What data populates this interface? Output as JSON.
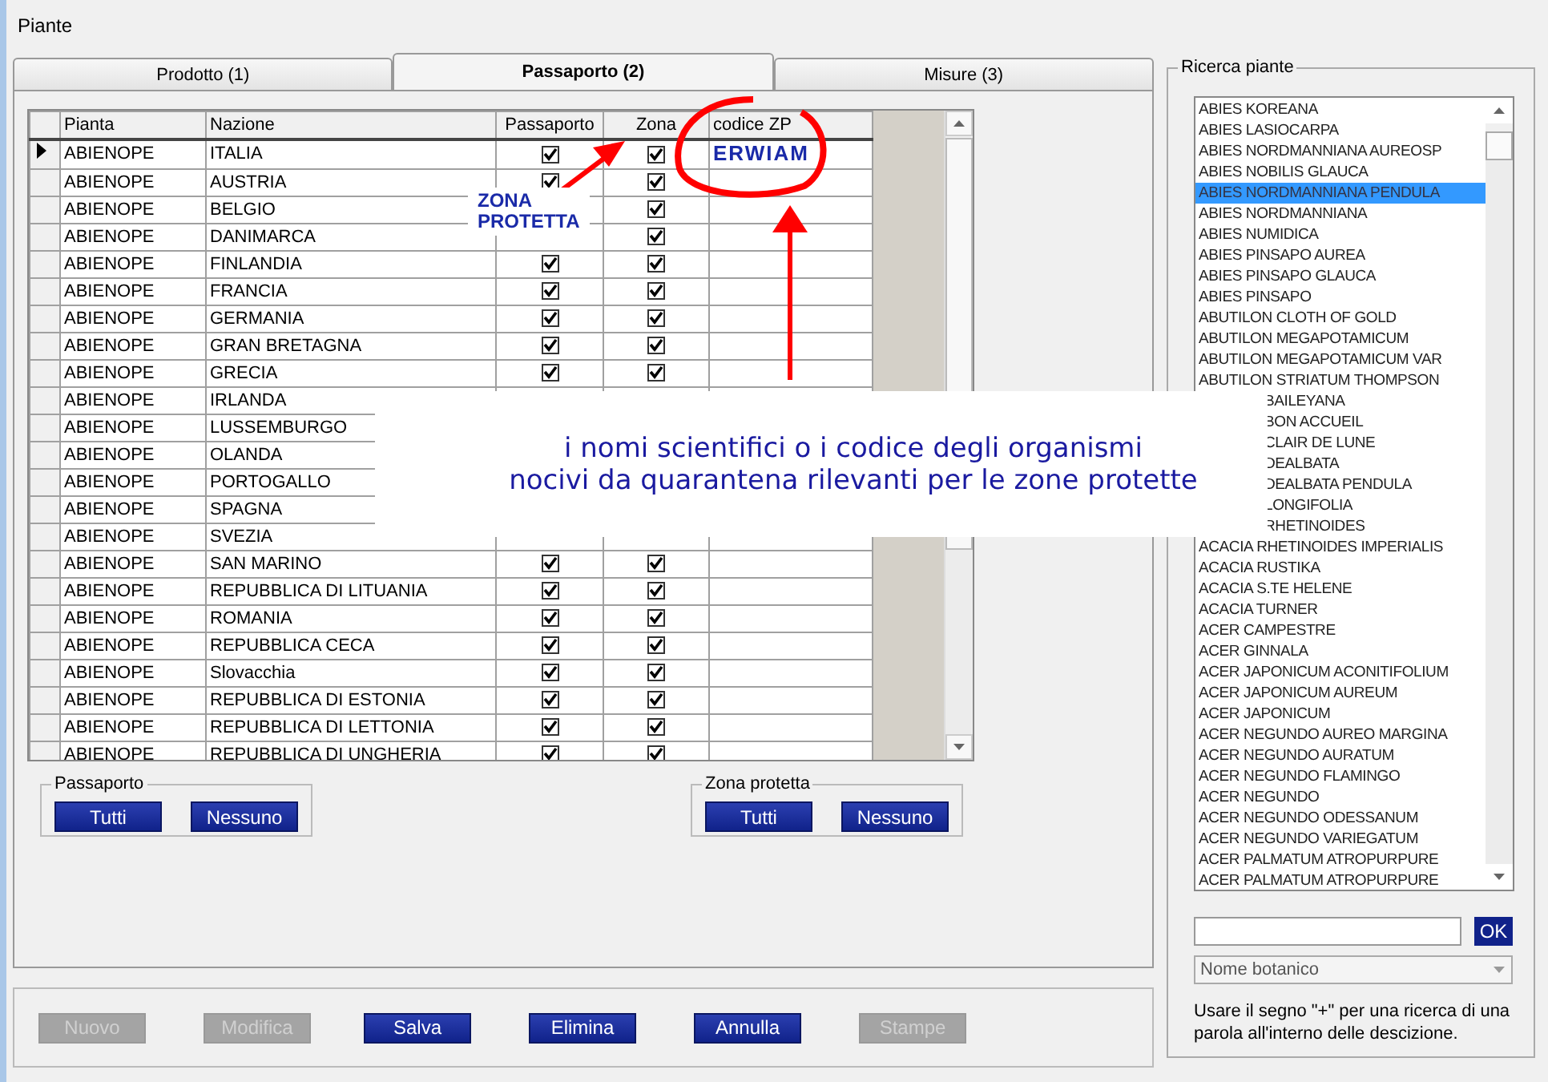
{
  "window": {
    "title": "Piante"
  },
  "tabs": [
    {
      "label": "Prodotto (1)",
      "selected": false
    },
    {
      "label": "Passaporto (2)",
      "selected": true
    },
    {
      "label": "Misure (3)",
      "selected": false
    }
  ],
  "table": {
    "columns": [
      "Pianta",
      "Nazione",
      "Passaporto",
      "Zona",
      "codice ZP"
    ],
    "rows": [
      {
        "current": true,
        "pianta": "ABIENOPE",
        "nazione": "ITALIA",
        "passaporto": true,
        "zona": true,
        "codice": "ERWIAM"
      },
      {
        "current": false,
        "pianta": "ABIENOPE",
        "nazione": "AUSTRIA",
        "passaporto": true,
        "zona": true
      },
      {
        "current": false,
        "pianta": "ABIENOPE",
        "nazione": "BELGIO",
        "zona": true
      },
      {
        "current": false,
        "pianta": "ABIENOPE",
        "nazione": "DANIMARCA",
        "zona": true
      },
      {
        "current": false,
        "pianta": "ABIENOPE",
        "nazione": "FINLANDIA",
        "passaporto": true,
        "zona": true
      },
      {
        "current": false,
        "pianta": "ABIENOPE",
        "nazione": "FRANCIA",
        "passaporto": true,
        "zona": true
      },
      {
        "current": false,
        "pianta": "ABIENOPE",
        "nazione": "GERMANIA",
        "passaporto": true,
        "zona": true
      },
      {
        "current": false,
        "pianta": "ABIENOPE",
        "nazione": "GRAN BRETAGNA",
        "passaporto": true,
        "zona": true
      },
      {
        "current": false,
        "pianta": "ABIENOPE",
        "nazione": "GRECIA",
        "passaporto": true,
        "zona": true
      },
      {
        "current": false,
        "pianta": "ABIENOPE",
        "nazione": "IRLANDA"
      },
      {
        "current": false,
        "pianta": "ABIENOPE",
        "nazione": "LUSSEMBURGO"
      },
      {
        "current": false,
        "pianta": "ABIENOPE",
        "nazione": "OLANDA"
      },
      {
        "current": false,
        "pianta": "ABIENOPE",
        "nazione": "PORTOGALLO"
      },
      {
        "current": false,
        "pianta": "ABIENOPE",
        "nazione": "SPAGNA"
      },
      {
        "current": false,
        "pianta": "ABIENOPE",
        "nazione": "SVEZIA"
      },
      {
        "current": false,
        "pianta": "ABIENOPE",
        "nazione": "SAN MARINO",
        "passaporto": true,
        "zona": true
      },
      {
        "current": false,
        "pianta": "ABIENOPE",
        "nazione": "REPUBBLICA DI LITUANIA",
        "passaporto": true,
        "zona": true
      },
      {
        "current": false,
        "pianta": "ABIENOPE",
        "nazione": "ROMANIA",
        "passaporto": true,
        "zona": true
      },
      {
        "current": false,
        "pianta": "ABIENOPE",
        "nazione": "REPUBBLICA CECA",
        "passaporto": true,
        "zona": true
      },
      {
        "current": false,
        "pianta": "ABIENOPE",
        "nazione": "Slovacchia",
        "passaporto": true,
        "zona": true
      },
      {
        "current": false,
        "pianta": "ABIENOPE",
        "nazione": "REPUBBLICA DI ESTONIA",
        "passaporto": true,
        "zona": true
      },
      {
        "current": false,
        "pianta": "ABIENOPE",
        "nazione": "REPUBBLICA DI LETTONIA",
        "passaporto": true,
        "zona": true
      },
      {
        "current": false,
        "pianta": "ABIENOPE",
        "nazione": "REPUBBLICA DI UNGHERIA",
        "passaporto": true,
        "zona": true
      }
    ]
  },
  "groups": [
    {
      "title": "Passaporto",
      "buttons": [
        "Tutti",
        "Nessuno"
      ]
    },
    {
      "title": "Zona protetta",
      "buttons": [
        "Tutti",
        "Nessuno"
      ]
    }
  ],
  "actions": [
    {
      "label": "Nuovo",
      "disabled": true
    },
    {
      "label": "Modifica",
      "disabled": true
    },
    {
      "label": "Salva",
      "disabled": false
    },
    {
      "label": "Elimina",
      "disabled": false
    },
    {
      "label": "Annulla",
      "disabled": false
    },
    {
      "label": "Stampe",
      "disabled": true
    }
  ],
  "search": {
    "title": "Ricerca piante",
    "items": [
      {
        "kind": "full",
        "text": "ABIES KOREANA",
        "selected": false
      },
      {
        "kind": "full",
        "text": "ABIES LASIOCARPA",
        "selected": false
      },
      {
        "kind": "full",
        "text": "ABIES NORDMANNIANA AUREOSP",
        "selected": false
      },
      {
        "kind": "full",
        "text": "ABIES NOBILIS GLAUCA",
        "selected": false
      },
      {
        "kind": "full",
        "text": "ABIES NORDMANNIANA PENDULA",
        "selected": true
      },
      {
        "kind": "full",
        "text": "ABIES NORDMANNIANA",
        "selected": false
      },
      {
        "kind": "full",
        "text": "ABIES NUMIDICA",
        "selected": false
      },
      {
        "kind": "full",
        "text": "ABIES PINSAPO AUREA",
        "selected": false
      },
      {
        "kind": "full",
        "text": "ABIES PINSAPO GLAUCA",
        "selected": false
      },
      {
        "kind": "full",
        "text": "ABIES PINSAPO",
        "selected": false
      },
      {
        "kind": "full",
        "text": "ABUTILON CLOTH OF GOLD",
        "selected": false
      },
      {
        "kind": "full",
        "text": "ABUTILON MEGAPOTAMICUM",
        "selected": false
      },
      {
        "kind": "full",
        "text": "ABUTILON MEGAPOTAMICUM VAR",
        "selected": false
      },
      {
        "kind": "full",
        "text": "ABUTILON STRIATUM THOMPSON",
        "selected": false
      },
      {
        "kind": "cut",
        "text": "BAILEYANA",
        "selected": false
      },
      {
        "kind": "cut",
        "text": "BON ACCUEIL",
        "selected": false
      },
      {
        "kind": "cut",
        "text": "CLAIR DE LUNE",
        "selected": false
      },
      {
        "kind": "cut",
        "text": "DEALBATA",
        "selected": false
      },
      {
        "kind": "cut",
        "text": "DEALBATA PENDULA",
        "selected": false
      },
      {
        "kind": "cut",
        "text": "LONGIFOLIA",
        "selected": false
      },
      {
        "kind": "cut",
        "text": "RHETINOIDES",
        "selected": false
      },
      {
        "kind": "full",
        "text": "ACACIA RHETINOIDES IMPERIALIS",
        "selected": false
      },
      {
        "kind": "full",
        "text": "ACACIA RUSTIKA",
        "selected": false
      },
      {
        "kind": "full",
        "text": "ACACIA S.TE HELENE",
        "selected": false
      },
      {
        "kind": "full",
        "text": "ACACIA TURNER",
        "selected": false
      },
      {
        "kind": "full",
        "text": "ACER CAMPESTRE",
        "selected": false
      },
      {
        "kind": "full",
        "text": "ACER GINNALA",
        "selected": false
      },
      {
        "kind": "full",
        "text": "ACER JAPONICUM ACONITIFOLIUM",
        "selected": false
      },
      {
        "kind": "full",
        "text": "ACER JAPONICUM AUREUM",
        "selected": false
      },
      {
        "kind": "full",
        "text": "ACER JAPONICUM",
        "selected": false
      },
      {
        "kind": "full",
        "text": "ACER NEGUNDO AUREO MARGINA",
        "selected": false
      },
      {
        "kind": "full",
        "text": "ACER NEGUNDO AURATUM",
        "selected": false
      },
      {
        "kind": "full",
        "text": "ACER NEGUNDO FLAMINGO",
        "selected": false
      },
      {
        "kind": "full",
        "text": "ACER NEGUNDO",
        "selected": false
      },
      {
        "kind": "full",
        "text": "ACER NEGUNDO ODESSANUM",
        "selected": false
      },
      {
        "kind": "full",
        "text": "ACER NEGUNDO VARIEGATUM",
        "selected": false
      },
      {
        "kind": "full",
        "text": "ACER PALMATUM ATROPURPURE",
        "selected": false
      },
      {
        "kind": "full",
        "text": "ACER PALMATUM ATROPURPURE",
        "selected": false
      }
    ],
    "ok": "OK",
    "mode": "Nome botanico",
    "hint": "Usare il segno \"+\" per una ricerca  di una parola all'interno delle descizione."
  },
  "annotations": {
    "label": "ZONA PROTETTA",
    "note": "i nomi scientifici o i codice degli organismi\nnocivi da quarantena rilevanti per le zone protette"
  }
}
